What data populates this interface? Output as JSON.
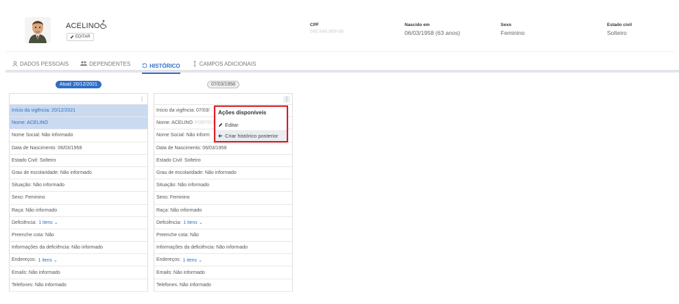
{
  "person": {
    "name": "ACELINO",
    "edit_label": "EDITAR",
    "fields": [
      {
        "label": "CPF",
        "value": "040.644.909-08",
        "blurred": true
      },
      {
        "label": "Nascido em",
        "value": "06/03/1958 (63 anos)",
        "blurred": false
      },
      {
        "label": "Sexo",
        "value": "Feminino",
        "blurred": false
      },
      {
        "label": "Estado civil",
        "value": "Solteiro",
        "blurred": false
      }
    ]
  },
  "tabs": [
    {
      "label": "DADOS PESSOAIS",
      "icon": "user-icon",
      "active": false
    },
    {
      "label": "DEPENDENTES",
      "icon": "users-icon",
      "active": false
    },
    {
      "label": "HISTÓRICO",
      "icon": "history-icon",
      "active": true
    },
    {
      "label": "CAMPOS ADICIONAIS",
      "icon": "text-cursor-icon",
      "active": false
    }
  ],
  "history": [
    {
      "date": "Atual: 20/12/2021",
      "current": true,
      "rows": [
        {
          "text": "Início da vigência: 20/12/2021",
          "hl": true
        },
        {
          "text": "Nome: ACELINO",
          "hl": true
        },
        {
          "text": "Nome Social: Não informado"
        },
        {
          "text": "Data de Nascimento: 06/03/1958"
        },
        {
          "text": "Estado Civil: Solteiro"
        },
        {
          "text": "Grau de escolaridade: Não informado"
        },
        {
          "text": "Situação: Não informado"
        },
        {
          "text": "Sexo: Feminino"
        },
        {
          "text": "Raça: Não informado"
        },
        {
          "text": "Deficiência:",
          "link": "1 itens ⌄"
        },
        {
          "text": "Preenche cota: Não"
        },
        {
          "text": "Informações da deficiência: Não informado"
        },
        {
          "text": "Endereços:",
          "link": "1 itens ⌄"
        },
        {
          "text": "Emails: Não informado"
        },
        {
          "text": "Telefones: Não informado"
        }
      ]
    },
    {
      "date": "07/03/1958",
      "current": false,
      "rows": [
        {
          "text": "Início da vigência: 07/03/"
        },
        {
          "text": "Nome: ACELINO",
          "blur": "PORTO B"
        },
        {
          "text": "Nome Social: Não inform"
        },
        {
          "text": "Data de Nascimento: 06/03/1958"
        },
        {
          "text": "Estado Civil: Solteiro"
        },
        {
          "text": "Grau de escolaridade: Não informado"
        },
        {
          "text": "Situação: Não informado"
        },
        {
          "text": "Sexo: Feminino"
        },
        {
          "text": "Raça: Não informado"
        },
        {
          "text": "Deficiência:",
          "link": "1 itens ⌄"
        },
        {
          "text": "Preenche cota: Não"
        },
        {
          "text": "Informações da deficiência: Não informado"
        },
        {
          "text": "Endereços:",
          "link": "1 itens ⌄"
        },
        {
          "text": "Emails: Não informado"
        },
        {
          "text": "Telefones: Não informado"
        }
      ]
    }
  ],
  "menu": {
    "title": "Ações disponíveis",
    "items": [
      {
        "label": "Editar",
        "icon": "pencil-icon"
      },
      {
        "label": "Criar histórico posterior",
        "icon": "arrow-left-icon"
      }
    ]
  },
  "colors": {
    "accent": "#2f6fc7",
    "highlight": "#c9daf1",
    "menu_border": "#e0141c"
  }
}
